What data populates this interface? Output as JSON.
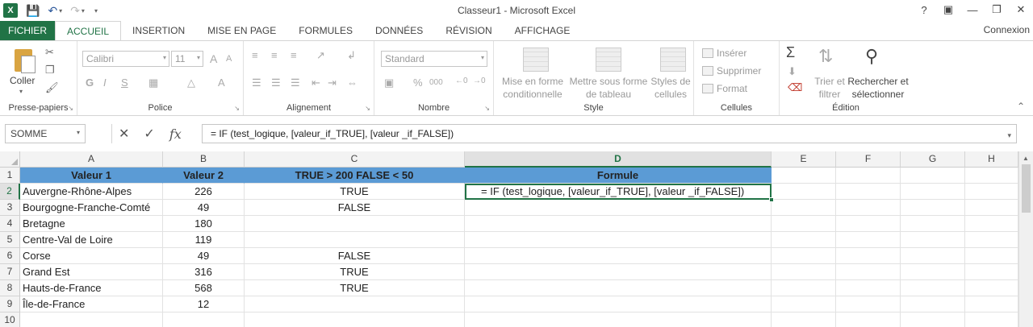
{
  "window": {
    "title": "Classeur1 - Microsoft Excel"
  },
  "title_controls": [
    "?",
    "▣",
    "—",
    "❐",
    "✕"
  ],
  "tabs": [
    {
      "label": "FICHIER"
    },
    {
      "label": "ACCUEIL"
    },
    {
      "label": "INSERTION"
    },
    {
      "label": "MISE EN PAGE"
    },
    {
      "label": "FORMULES"
    },
    {
      "label": "DONNÉES"
    },
    {
      "label": "RÉVISION"
    },
    {
      "label": "AFFICHAGE"
    }
  ],
  "account": "Connexion",
  "ribbon": {
    "clipboard": {
      "paste_label": "Coller",
      "group_label": "Presse-papiers"
    },
    "font": {
      "name": "Calibri",
      "size": "11",
      "bold": "G",
      "italic": "I",
      "underline": "S",
      "grow": "A",
      "shrink": "A",
      "color": "A",
      "group_label": "Police"
    },
    "alignment": {
      "group_label": "Alignement"
    },
    "number": {
      "format": "Standard",
      "percent": "%",
      "thousands": "000",
      "group_label": "Nombre"
    },
    "style": {
      "conditional": [
        "Mise en forme",
        "conditionnelle"
      ],
      "as_table": [
        "Mettre sous forme",
        "de tableau"
      ],
      "cell_styles": [
        "Styles de",
        "cellules"
      ],
      "group_label": "Style"
    },
    "cells": {
      "insert": "Insérer",
      "delete": "Supprimer",
      "format": "Format",
      "group_label": "Cellules"
    },
    "editing": {
      "sort": [
        "Trier et",
        "filtrer"
      ],
      "find": [
        "Rechercher et",
        "sélectionner"
      ],
      "group_label": "Édition"
    }
  },
  "formula_bar": {
    "name_box": "SOMME",
    "formula": "= IF (test_logique, [valeur_if_TRUE], [valeur _if_FALSE])"
  },
  "sheet": {
    "columns": [
      "A",
      "B",
      "C",
      "D",
      "E",
      "F",
      "G",
      "H"
    ],
    "rows": [
      "1",
      "2",
      "3",
      "4",
      "5",
      "6",
      "7",
      "8",
      "9",
      "10"
    ],
    "cells": {
      "A1": "Valeur 1",
      "B1": "Valeur 2",
      "C1": "TRUE > 200 FALSE < 50",
      "D1": "Formule",
      "A2": "Auvergne-Rhône-Alpes",
      "B2": "226",
      "C2": "TRUE",
      "D2": "= IF (test_logique, [valeur_if_TRUE], [valeur _if_FALSE])",
      "A3": "Bourgogne-Franche-Comté",
      "B3": "49",
      "C3": "FALSE",
      "A4": "Bretagne",
      "B4": "180",
      "A5": "Centre-Val de Loire",
      "B5": "119",
      "A6": "Corse",
      "B6": "49",
      "C6": "FALSE",
      "A7": "Grand Est",
      "B7": "316",
      "C7": "TRUE",
      "A8": "Hauts-de-France",
      "B8": "568",
      "C8": "TRUE",
      "A9": "Île-de-France",
      "B9": "12"
    }
  },
  "colors": {
    "accent": "#217346",
    "header_fill": "#5b9bd5"
  }
}
